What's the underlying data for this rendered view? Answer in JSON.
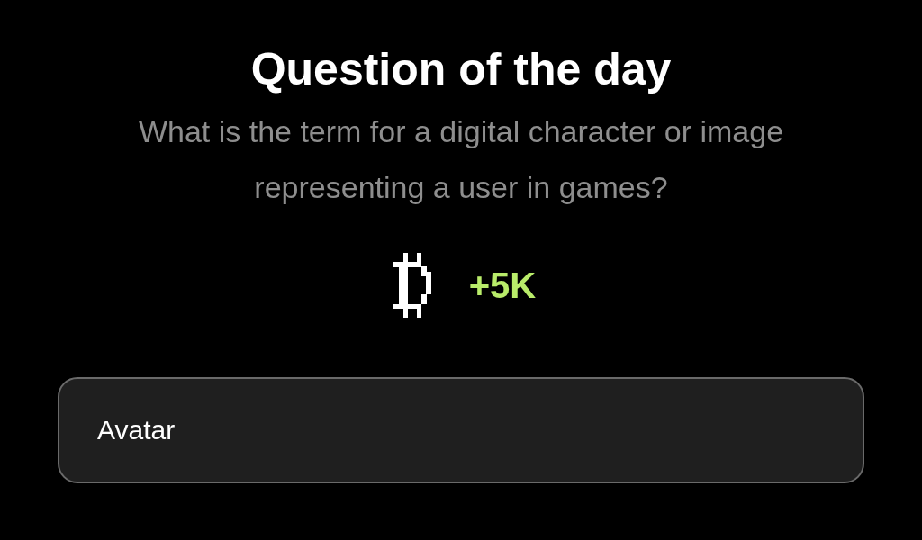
{
  "title": "Question of the day",
  "question": "What is the term for a digital character or image representing a user in games?",
  "reward": {
    "amount": "+5K"
  },
  "answer_field": {
    "value": "Avatar"
  }
}
